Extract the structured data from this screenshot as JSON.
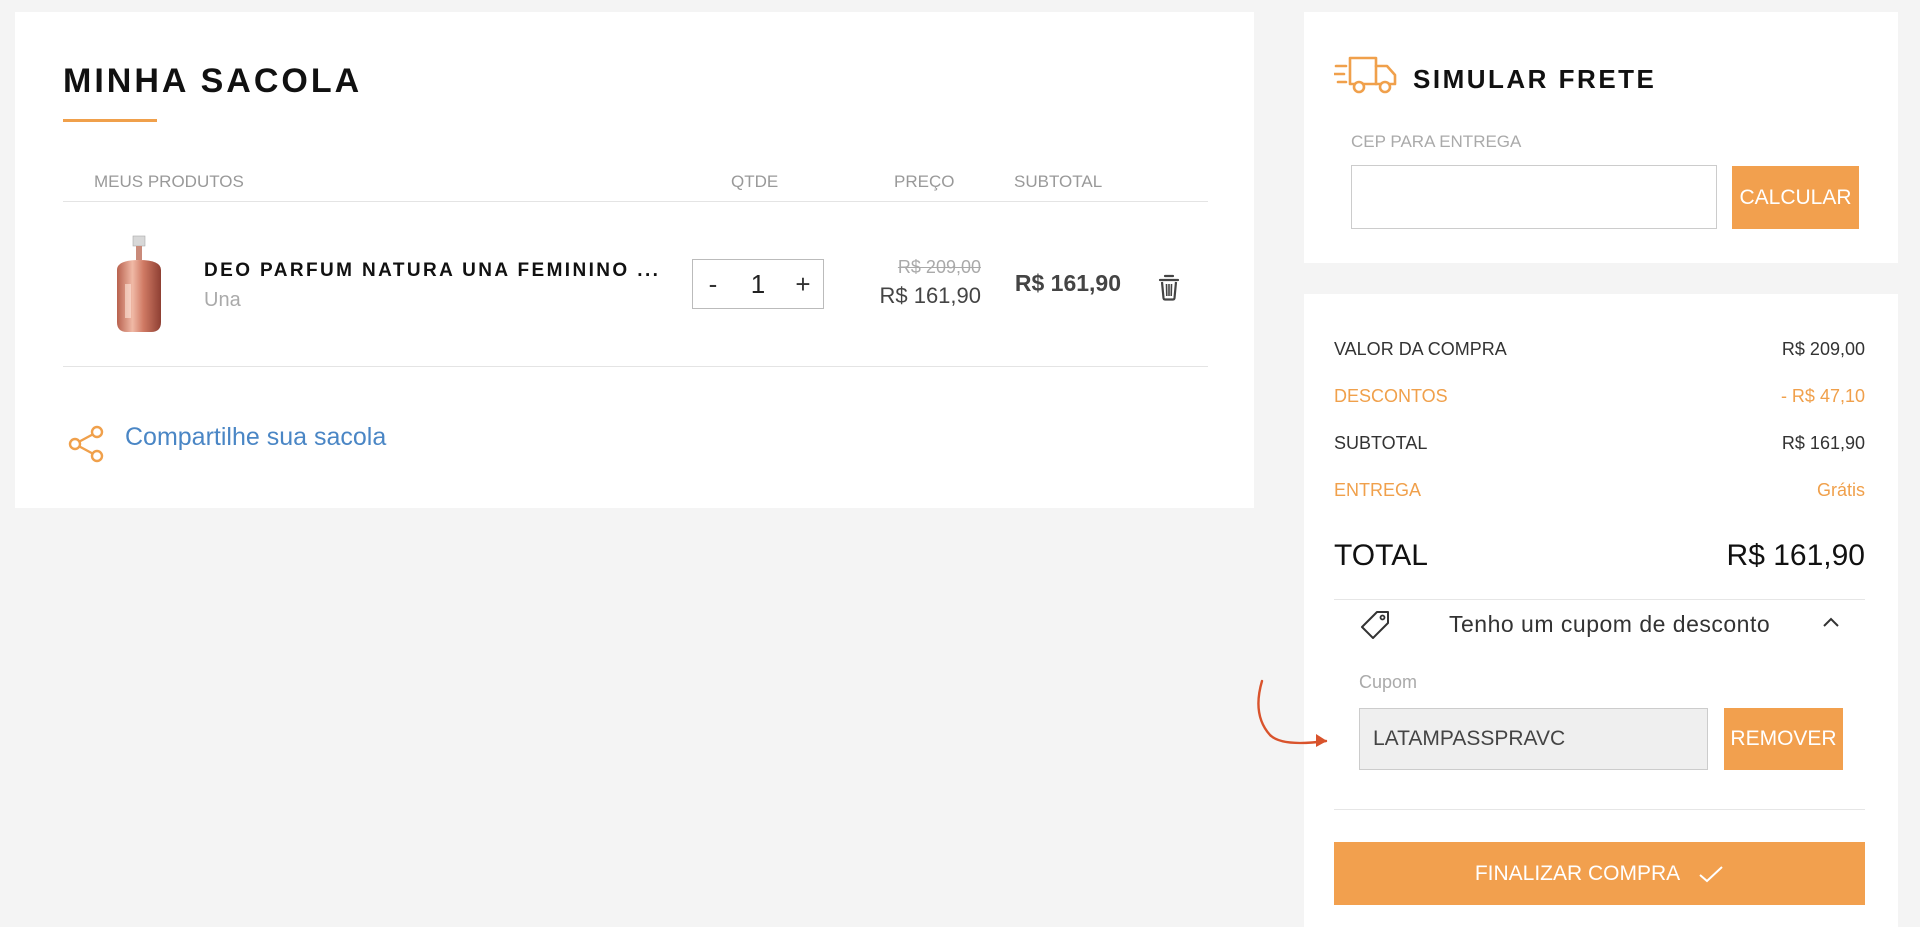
{
  "cart": {
    "title": "MINHA SACOLA",
    "columns": {
      "products": "MEUS PRODUTOS",
      "qty": "QTDE",
      "price": "PREÇO",
      "subtotal": "SUBTOTAL"
    },
    "item": {
      "name": "DEO PARFUM NATURA UNA FEMININO ...",
      "brand": "Una",
      "quantity": "1",
      "qty_minus": "-",
      "qty_plus": "+",
      "price_old": "R$ 209,00",
      "price_new": "R$ 161,90",
      "subtotal": "R$ 161,90"
    },
    "share_label": "Compartilhe sua sacola"
  },
  "shipping": {
    "title": "SIMULAR FRETE",
    "cep_label": "CEP PARA ENTREGA",
    "cep_value": "",
    "calc_label": "CALCULAR"
  },
  "summary": {
    "rows": [
      {
        "label": "VALOR DA COMPRA",
        "value": "R$ 209,00"
      },
      {
        "label": "DESCONTOS",
        "value": "- R$ 47,10"
      },
      {
        "label": "SUBTOTAL",
        "value": "R$ 161,90"
      },
      {
        "label": "ENTREGA",
        "value": "Grátis"
      }
    ],
    "total_label": "TOTAL",
    "total_value": "R$ 161,90",
    "coupon_toggle": "Tenho um cupom de desconto",
    "coupon_label": "Cupom",
    "coupon_value": "LATAMPASSPRAVC",
    "remove_label": "REMOVER",
    "checkout_label": "FINALIZAR COMPRA"
  },
  "colors": {
    "accent": "#f2a04e",
    "link": "#4a86c5",
    "arrow": "#d9532c"
  }
}
